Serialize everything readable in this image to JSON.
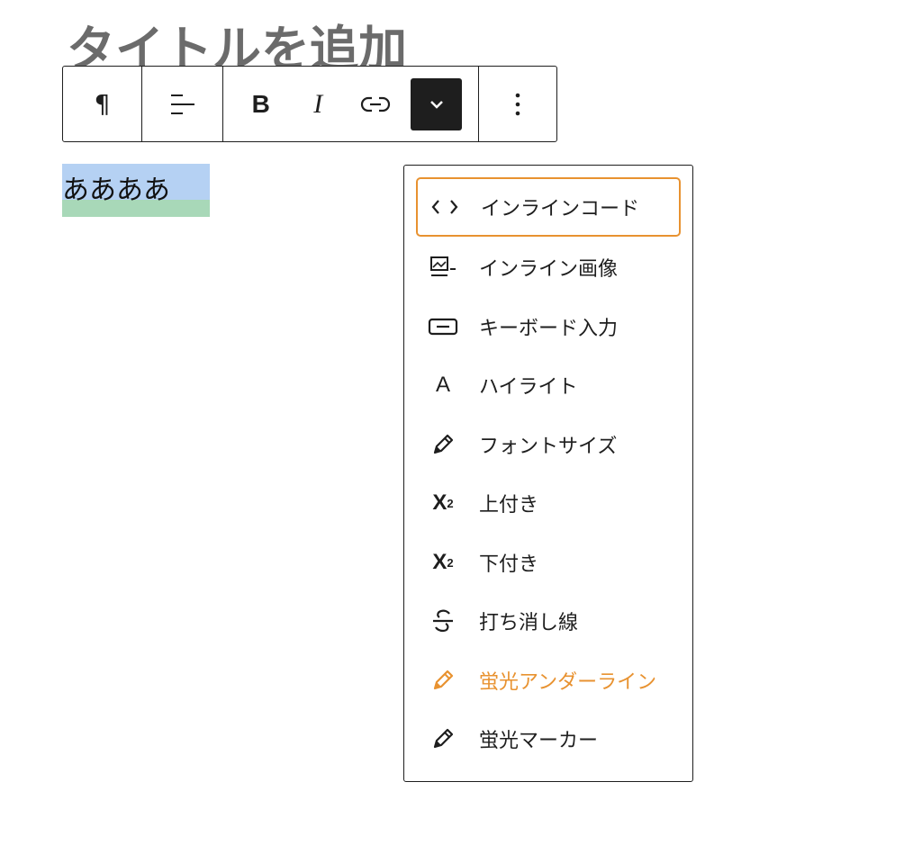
{
  "editor": {
    "title_placeholder": "タイトルを追加",
    "selected_text": "ああああ"
  },
  "toolbar": {
    "paragraph_icon": "paragraph-icon",
    "align_icon": "align-left-icon",
    "bold_label": "B",
    "italic_label": "I",
    "link_icon": "link-icon",
    "more_formats_icon": "chevron-down-icon",
    "options_icon": "more-vertical-icon"
  },
  "format_menu": {
    "items": [
      {
        "label": "インラインコード",
        "icon": "code-icon",
        "focused": true
      },
      {
        "label": "インライン画像",
        "icon": "image-icon"
      },
      {
        "label": "キーボード入力",
        "icon": "keyboard-icon"
      },
      {
        "label": "ハイライト",
        "icon": "highlight-icon"
      },
      {
        "label": "フォントサイズ",
        "icon": "pencil-icon"
      },
      {
        "label": "上付き",
        "icon": "superscript-icon"
      },
      {
        "label": "下付き",
        "icon": "subscript-icon"
      },
      {
        "label": "打ち消し線",
        "icon": "strikethrough-icon"
      },
      {
        "label": "蛍光アンダーライン",
        "icon": "pencil-icon",
        "accent": true
      },
      {
        "label": "蛍光マーカー",
        "icon": "pencil-icon"
      }
    ]
  },
  "colors": {
    "accent": "#e89230",
    "selection_blue": "#b5d1f3",
    "selection_green": "#a8d8b8",
    "dark": "#1e1e1e"
  }
}
